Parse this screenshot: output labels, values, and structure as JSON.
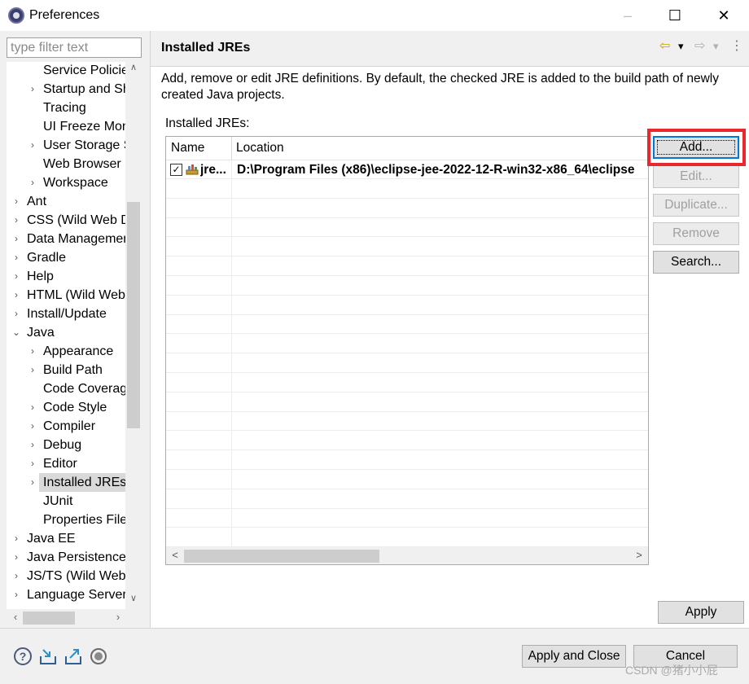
{
  "window": {
    "title": "Preferences",
    "minimize_glyph": "–",
    "maximize_glyph": "☐",
    "close_glyph": "✕"
  },
  "filter": {
    "placeholder": "type filter text",
    "value": ""
  },
  "tree": {
    "items": [
      {
        "label": "Service Policies",
        "expander": ""
      },
      {
        "label": "Startup and Shutdown",
        "expander": "›"
      },
      {
        "label": "Tracing",
        "expander": ""
      },
      {
        "label": "UI Freeze Monitoring",
        "expander": ""
      },
      {
        "label": "User Storage Service",
        "expander": "›"
      },
      {
        "label": "Web Browser",
        "expander": ""
      },
      {
        "label": "Workspace",
        "expander": "›"
      },
      {
        "label": "Ant",
        "expander": "›"
      },
      {
        "label": "CSS (Wild Web Developer)",
        "expander": "›"
      },
      {
        "label": "Data Management",
        "expander": "›"
      },
      {
        "label": "Gradle",
        "expander": "›"
      },
      {
        "label": "Help",
        "expander": "›"
      },
      {
        "label": "HTML (Wild Web Developer)",
        "expander": "›"
      },
      {
        "label": "Install/Update",
        "expander": "›"
      },
      {
        "label": "Java",
        "expander": "⌄"
      },
      {
        "label": "Appearance",
        "expander": "›"
      },
      {
        "label": "Build Path",
        "expander": "›"
      },
      {
        "label": "Code Coverage",
        "expander": ""
      },
      {
        "label": "Code Style",
        "expander": "›"
      },
      {
        "label": "Compiler",
        "expander": "›"
      },
      {
        "label": "Debug",
        "expander": "›"
      },
      {
        "label": "Editor",
        "expander": "›"
      },
      {
        "label": "Installed JREs",
        "expander": "›",
        "selected": true
      },
      {
        "label": "JUnit",
        "expander": ""
      },
      {
        "label": "Properties Files Editor",
        "expander": ""
      },
      {
        "label": "Java EE",
        "expander": "›"
      },
      {
        "label": "Java Persistence",
        "expander": "›"
      },
      {
        "label": "JS/TS (Wild Web Developer)",
        "expander": "›"
      },
      {
        "label": "Language Servers",
        "expander": "›"
      }
    ],
    "scroll_up": "∧",
    "scroll_down": "∨",
    "scroll_left": "‹",
    "scroll_right": "›"
  },
  "page": {
    "title": "Installed JREs",
    "description": "Add, remove or edit JRE definitions. By default, the checked JRE is added to the build path of newly created Java projects.",
    "installed_label": "Installed JREs:",
    "nav": {
      "back": "⇦",
      "dropdown": "▾",
      "forward": "⇨",
      "menu": "⋮"
    }
  },
  "jre_table": {
    "headers": {
      "name": "Name",
      "location": "Location"
    },
    "rows": [
      {
        "name": "jre...",
        "location": "D:\\Program Files (x86)\\eclipse-jee-2022-12-R-win32-x86_64\\eclipse",
        "checked": true
      }
    ],
    "scroll_left": "<",
    "scroll_right": ">"
  },
  "buttons": {
    "add": "Add...",
    "edit": "Edit...",
    "duplicate": "Duplicate...",
    "remove": "Remove",
    "search": "Search...",
    "apply": "Apply",
    "apply_and_close": "Apply and Close",
    "cancel": "Cancel"
  },
  "watermark": "CSDN @猪小小屁",
  "colors": {
    "accent": "#0078d7",
    "highlight_box": "#e8282c",
    "selected_row": "#d9d9d9"
  }
}
